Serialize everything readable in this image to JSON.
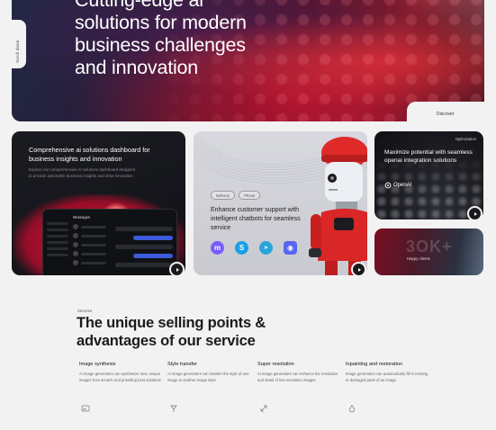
{
  "hero": {
    "title_lines": [
      "Cutting-edge ai",
      "solutions for modern",
      "business challenges",
      "and innovation"
    ],
    "side_tab_label": "Scroll down",
    "discover_label": "Discover"
  },
  "cards": {
    "dashboard": {
      "title": "Comprehensive ai solutions dashboard for business insights and innovation",
      "description": "Explore our comprehensive AI solutions dashboard designed to provide actionable business insights and drive innovation",
      "screen_title": "Messages"
    },
    "support": {
      "tags": [
        "Delivery",
        "Phone"
      ],
      "title": "Enhance customer support with intelligent chatbots for seamless service",
      "apps": [
        {
          "icon": "messenger-icon",
          "glyph": "m",
          "color": "#7b5cff"
        },
        {
          "icon": "skype-icon",
          "glyph": "S",
          "color": "#1a9fe6"
        },
        {
          "icon": "telegram-icon",
          "glyph": "➤",
          "color": "#2aa3dc"
        },
        {
          "icon": "discord-icon",
          "glyph": "◉",
          "color": "#5865f2"
        }
      ]
    },
    "openai": {
      "badge": "Optimization",
      "title": "Maximize potential with seamless openai integration solutions",
      "brand": "OpenAI"
    },
    "clients": {
      "big_text": "3OK+",
      "label": "Happy clients"
    }
  },
  "services": {
    "section_label": "Services",
    "title": "The unique selling points & advantages of our service",
    "features": [
      {
        "title": "Image synthesis",
        "text": "AI image generators can synthesize new, unique images from scratch and providing best solutions",
        "icon": "image-icon"
      },
      {
        "title": "Style transfer",
        "text": "AI image generators can transfer the style of one image to another image style.",
        "icon": "brush-icon"
      },
      {
        "title": "Super resolution",
        "text": "AI image generators can enhance the resolution and detail of low-resolution images",
        "icon": "resolution-icon"
      },
      {
        "title": "Inpainting and restoration",
        "text": "Image generators can automatically fill in missing or damaged parts of an image.",
        "icon": "drop-icon"
      }
    ]
  }
}
